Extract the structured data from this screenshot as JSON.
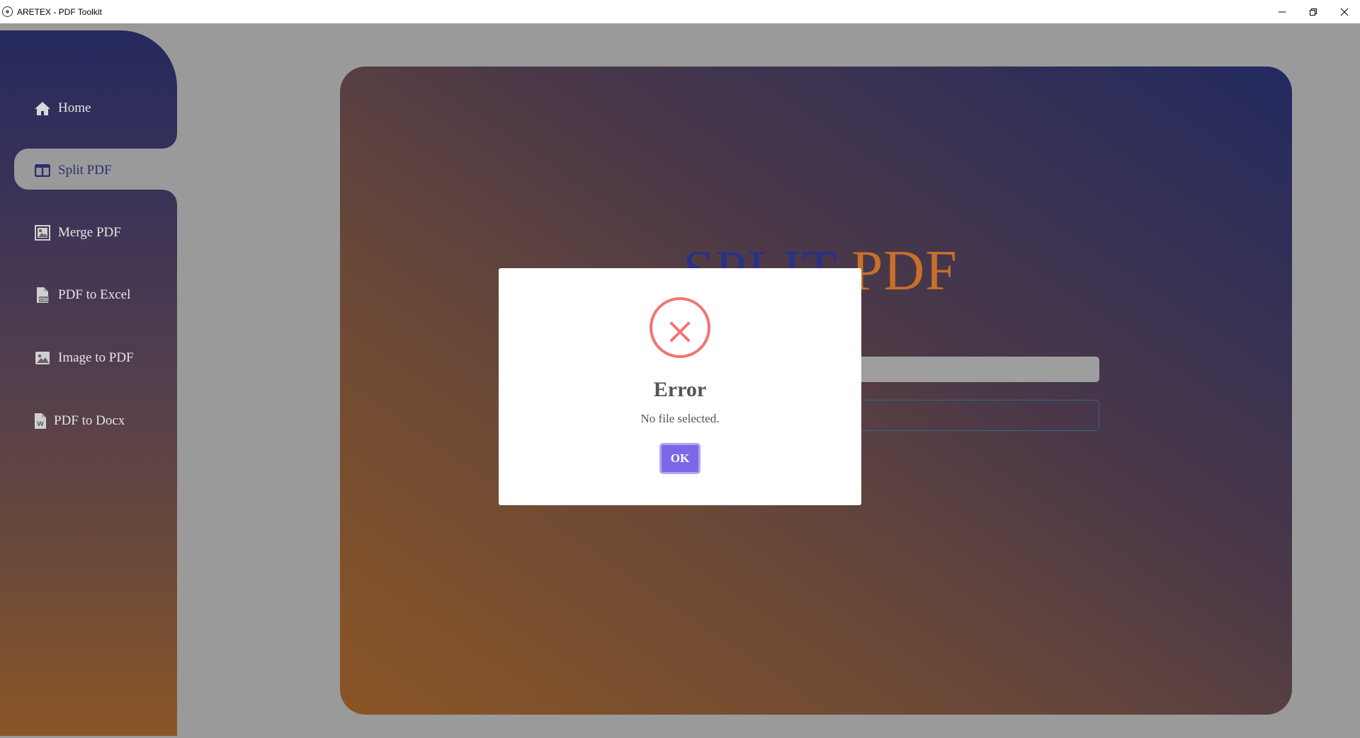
{
  "window": {
    "title": "ARETEX - PDF Toolkit",
    "icons": {
      "app": "app-logo-icon",
      "minimize": "minimize-icon",
      "restore": "restore-icon",
      "close": "close-icon"
    }
  },
  "sidebar": {
    "items": [
      {
        "label": "Home",
        "icon": "home-icon"
      },
      {
        "label": "Split PDF",
        "icon": "split-columns-icon",
        "active": true
      },
      {
        "label": "Merge PDF",
        "icon": "merge-image-icon"
      },
      {
        "label": "PDF to Excel",
        "icon": "csv-file-icon"
      },
      {
        "label": "Image to PDF",
        "icon": "image-icon"
      },
      {
        "label": "PDF to Docx",
        "icon": "word-file-icon"
      }
    ]
  },
  "main": {
    "title_part1": "SPLIT",
    "title_part2": "PDF"
  },
  "modal": {
    "icon": "error-x-icon",
    "title": "Error",
    "message": "No file selected.",
    "ok_label": "OK"
  },
  "colors": {
    "accent": "#7b68e8",
    "error": "#f27474",
    "title_blue": "#28308a",
    "title_orange": "#c8702a",
    "overlay": "#9a9a9a"
  }
}
